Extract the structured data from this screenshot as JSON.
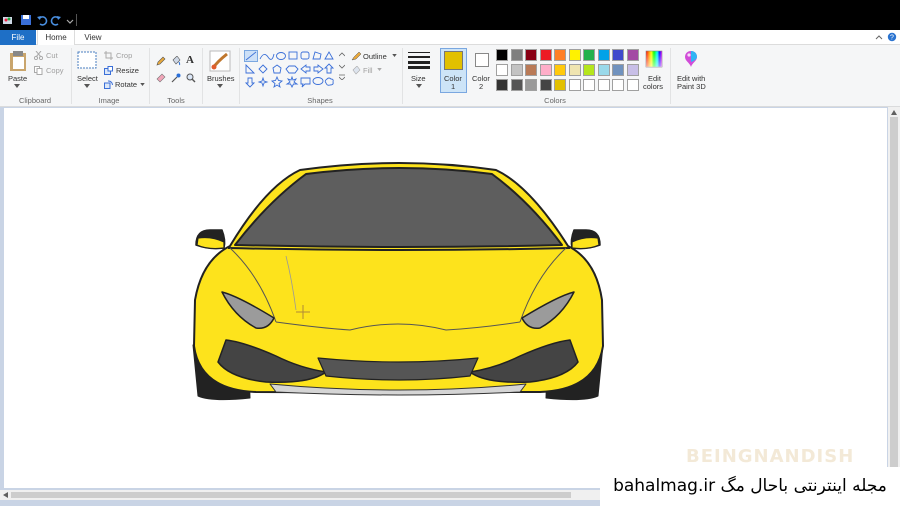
{
  "tabs": {
    "file": "File",
    "home": "Home",
    "view": "View"
  },
  "clipboard": {
    "paste": "Paste",
    "cut": "Cut",
    "copy": "Copy",
    "group": "Clipboard"
  },
  "image": {
    "select": "Select",
    "crop": "Crop",
    "resize": "Resize",
    "rotate": "Rotate",
    "group": "Image"
  },
  "tools": {
    "group": "Tools"
  },
  "brushes": {
    "label": "Brushes"
  },
  "shapes": {
    "outline": "Outline",
    "fill": "Fill",
    "group": "Shapes"
  },
  "size": {
    "label": "Size"
  },
  "colors": {
    "color1_label": "Color",
    "color1_num": "1",
    "color2_label": "Color",
    "color2_num": "2",
    "edit_colors_1": "Edit",
    "edit_colors_2": "colors",
    "paint3d_1": "Edit with",
    "paint3d_2": "Paint 3D",
    "group": "Colors",
    "color1_value": "#e2c000",
    "color2_value": "#ffffff",
    "palette_row1": [
      "#000000",
      "#7f7f7f",
      "#880015",
      "#ed1c24",
      "#ff7f27",
      "#fff200",
      "#22b14c",
      "#00a2e8",
      "#3f48cc",
      "#a349a4"
    ],
    "palette_row2": [
      "#ffffff",
      "#c3c3c3",
      "#b97a57",
      "#ffaec9",
      "#ffc90e",
      "#efe4b0",
      "#b5e61d",
      "#99d9ea",
      "#7092be",
      "#c8bfe7"
    ],
    "palette_row3": [
      "#333333",
      "#555555",
      "#999999",
      "#444444",
      "#e2c000",
      "#ffffff",
      "#ffffff",
      "#ffffff",
      "#ffffff",
      "#ffffff"
    ]
  },
  "car": {
    "body_color": "#fde31c",
    "glass_color": "#5e5e5e",
    "outline_color": "#222222"
  },
  "watermark": {
    "faint": "BEINGNANDISH",
    "text": "bahalmag.ir مجله اینترنتی باحال مگ"
  }
}
